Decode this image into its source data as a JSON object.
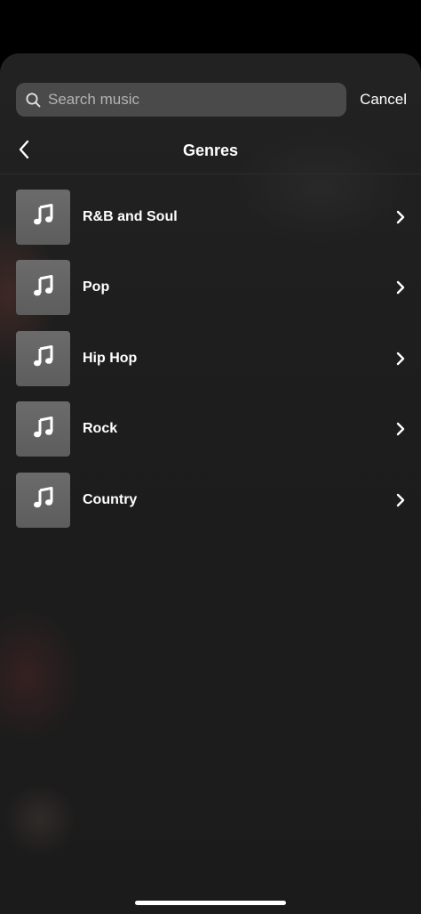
{
  "search": {
    "placeholder": "Search music",
    "value": "",
    "icon": "search-icon"
  },
  "cancel_label": "Cancel",
  "header": {
    "title": "Genres",
    "back_icon": "chevron-left-icon"
  },
  "genres": [
    {
      "label": "R&B and Soul",
      "icon": "music-note-icon"
    },
    {
      "label": "Pop",
      "icon": "music-note-icon"
    },
    {
      "label": "Hip Hop",
      "icon": "music-note-icon"
    },
    {
      "label": "Rock",
      "icon": "music-note-icon"
    },
    {
      "label": "Country",
      "icon": "music-note-icon"
    }
  ],
  "colors": {
    "background": "#1f1f1f",
    "search_box": "#4a4a4a",
    "thumbnail": "#666666",
    "text": "#ffffff",
    "placeholder": "#b3b3b3"
  }
}
